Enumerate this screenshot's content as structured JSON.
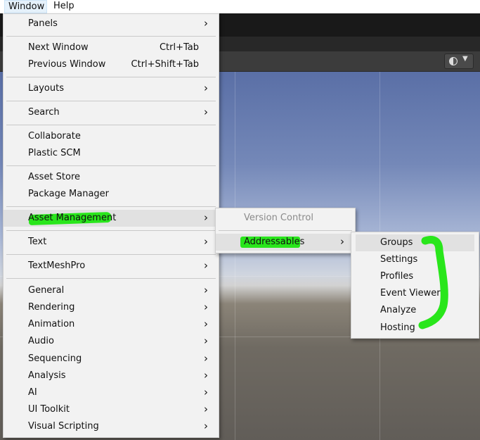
{
  "menubar": {
    "items": [
      {
        "label": "Window"
      },
      {
        "label": "Help"
      }
    ]
  },
  "window_menu": {
    "items": [
      {
        "label": "Panels",
        "submenu": true
      },
      {
        "label": "Next Window",
        "shortcut": "Ctrl+Tab"
      },
      {
        "label": "Previous Window",
        "shortcut": "Ctrl+Shift+Tab"
      },
      {
        "label": "Layouts",
        "submenu": true
      },
      {
        "label": "Search",
        "submenu": true
      },
      {
        "label": "Collaborate"
      },
      {
        "label": "Plastic SCM"
      },
      {
        "label": "Asset Store"
      },
      {
        "label": "Package Manager"
      },
      {
        "label": "Asset Management",
        "submenu": true
      },
      {
        "label": "Text",
        "submenu": true
      },
      {
        "label": "TextMeshPro",
        "submenu": true
      },
      {
        "label": "General",
        "submenu": true
      },
      {
        "label": "Rendering",
        "submenu": true
      },
      {
        "label": "Animation",
        "submenu": true
      },
      {
        "label": "Audio",
        "submenu": true
      },
      {
        "label": "Sequencing",
        "submenu": true
      },
      {
        "label": "Analysis",
        "submenu": true
      },
      {
        "label": "AI",
        "submenu": true
      },
      {
        "label": "UI Toolkit",
        "submenu": true
      },
      {
        "label": "Visual Scripting",
        "submenu": true
      }
    ]
  },
  "asset_management_menu": {
    "items": [
      {
        "label": "Version Control",
        "disabled": true
      },
      {
        "label": "Addressables",
        "submenu": true
      }
    ]
  },
  "addressables_menu": {
    "items": [
      {
        "label": "Groups"
      },
      {
        "label": "Settings"
      },
      {
        "label": "Profiles"
      },
      {
        "label": "Event Viewer"
      },
      {
        "label": "Analyze"
      },
      {
        "label": "Hosting"
      }
    ]
  },
  "glyphs": {
    "submenu_arrow": "›"
  },
  "colors": {
    "highlight_marker": "#29e61b",
    "menu_bg": "#f2f2f2",
    "menu_hover": "#e1e1e1"
  }
}
